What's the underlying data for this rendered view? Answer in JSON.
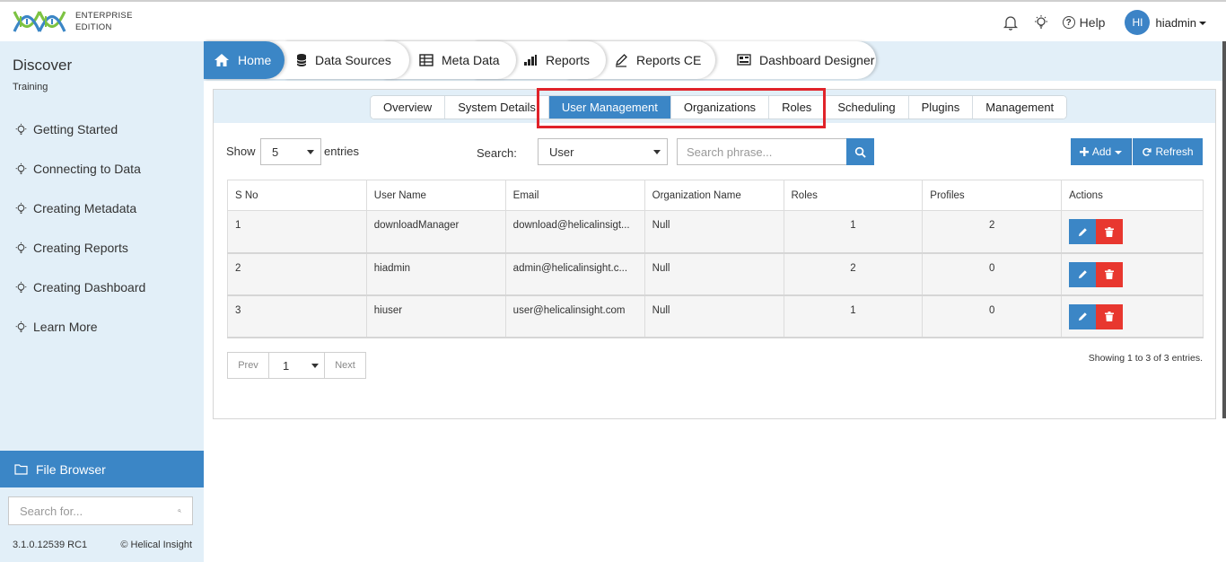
{
  "header": {
    "logo_line1": "ENTERPRISE",
    "logo_line2": "EDITION",
    "help_label": "Help",
    "avatar_initials": "HI",
    "username": "hiadmin"
  },
  "sidebar": {
    "title": "Discover",
    "subtitle": "Training",
    "items": [
      {
        "label": "Getting Started"
      },
      {
        "label": "Connecting to Data"
      },
      {
        "label": "Creating Metadata"
      },
      {
        "label": "Creating Reports"
      },
      {
        "label": "Creating Dashboard"
      },
      {
        "label": "Learn More"
      }
    ],
    "file_browser_label": "File Browser",
    "search_placeholder": "Search for...",
    "version": "3.1.0.12539 RC1",
    "copyright": "© Helical Insight"
  },
  "nav": {
    "tabs": [
      {
        "label": "Home",
        "icon": "home-icon",
        "active": true
      },
      {
        "label": "Data Sources",
        "icon": "database-icon"
      },
      {
        "label": "Meta Data",
        "icon": "table-icon"
      },
      {
        "label": "Reports",
        "icon": "bar-chart-icon"
      },
      {
        "label": "Reports CE",
        "icon": "pencil-icon"
      },
      {
        "label": "Dashboard Designer",
        "icon": "dashboard-icon"
      }
    ]
  },
  "subtabs": [
    {
      "label": "Overview"
    },
    {
      "label": "System Details"
    },
    {
      "label": "User Management",
      "active": true
    },
    {
      "label": "Organizations"
    },
    {
      "label": "Roles"
    },
    {
      "label": "Scheduling"
    },
    {
      "label": "Plugins"
    },
    {
      "label": "Management"
    }
  ],
  "controls": {
    "show_label": "Show",
    "show_value": "5",
    "entries_label": "entries",
    "search_label": "Search:",
    "search_type": "User",
    "search_placeholder": "Search phrase...",
    "add_label": "Add",
    "refresh_label": "Refresh"
  },
  "table": {
    "columns": [
      "S No",
      "User Name",
      "Email",
      "Organization Name",
      "Roles",
      "Profiles",
      "Actions"
    ],
    "rows": [
      {
        "sno": "1",
        "username": "downloadManager",
        "email": "download@helicalinsigt...",
        "org": "Null",
        "roles": "1",
        "profiles": "2"
      },
      {
        "sno": "2",
        "username": "hiadmin",
        "email": "admin@helicalinsight.c...",
        "org": "Null",
        "roles": "2",
        "profiles": "0"
      },
      {
        "sno": "3",
        "username": "hiuser",
        "email": "user@helicalinsight.com",
        "org": "Null",
        "roles": "1",
        "profiles": "0"
      }
    ]
  },
  "pager": {
    "prev_label": "Prev",
    "page_value": "1",
    "next_label": "Next",
    "showing_text": "Showing 1 to 3 of 3 entries."
  },
  "colors": {
    "accent": "#3b86c6",
    "danger": "#e8372f",
    "highlight": "#e0232a",
    "sidebar_bg": "#e2eff8"
  }
}
